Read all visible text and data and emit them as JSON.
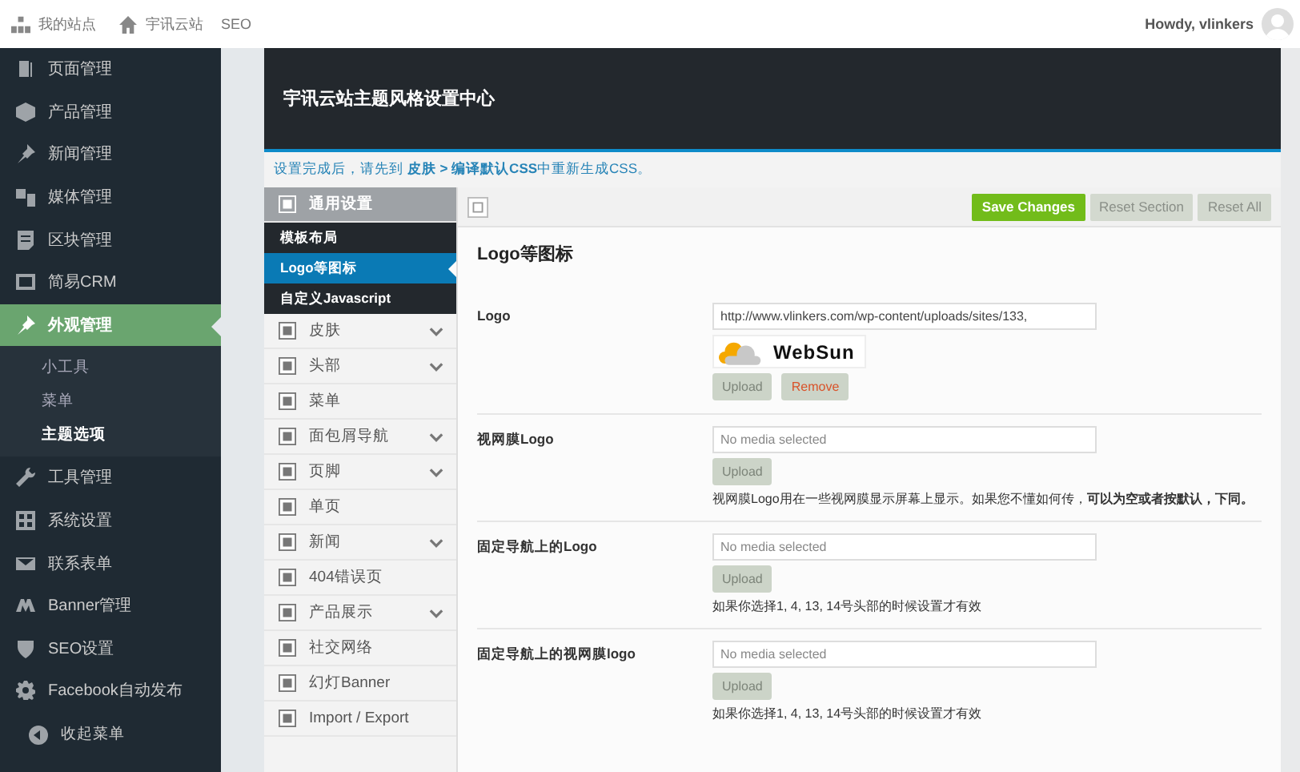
{
  "admin_bar": {
    "items": [
      "我的站点",
      "宇讯云站",
      "SEO"
    ],
    "greeting": "Howdy, vlinkers"
  },
  "sidebar": {
    "items": [
      {
        "label": "页面管理",
        "selected": false
      },
      {
        "label": "产品管理",
        "selected": false
      },
      {
        "label": "新闻管理",
        "selected": false
      },
      {
        "label": "媒体管理",
        "selected": false
      },
      {
        "label": "区块管理",
        "selected": false
      },
      {
        "label": "简易CRM",
        "selected": false
      },
      {
        "label": "外观管理",
        "selected": true,
        "children": [
          {
            "label": "小工具",
            "selected": false
          },
          {
            "label": "菜单",
            "selected": false
          },
          {
            "label": "主题选项",
            "selected": true
          }
        ]
      },
      {
        "label": "工具管理",
        "selected": false
      },
      {
        "label": "系统设置",
        "selected": false
      },
      {
        "label": "联系表单",
        "selected": false
      },
      {
        "label": "Banner管理",
        "selected": false
      },
      {
        "label": "SEO设置",
        "selected": false
      },
      {
        "label": "Facebook自动发布",
        "selected": false
      }
    ],
    "collapse": "收起菜单"
  },
  "header": {
    "title": "宇讯云站主题风格设置中心",
    "notice": "设置完成后，请先到 **皮肤 > 编译默认CSS**中重新生成CSS。"
  },
  "options_nav": [
    {
      "label": "通用设置",
      "expanded": true,
      "has_submenu": false,
      "children": [
        {
          "label": "模板布局",
          "selected": false
        },
        {
          "label": "Logo等图标",
          "selected": true
        },
        {
          "label": "自定义Javascript",
          "selected": false
        }
      ]
    },
    {
      "label": "皮肤",
      "expanded": false,
      "has_submenu": true
    },
    {
      "label": "头部",
      "expanded": false,
      "has_submenu": true
    },
    {
      "label": "菜单",
      "expanded": false,
      "has_submenu": false
    },
    {
      "label": "面包屑导航",
      "expanded": false,
      "has_submenu": true
    },
    {
      "label": "页脚",
      "expanded": false,
      "has_submenu": true
    },
    {
      "label": "单页",
      "expanded": false,
      "has_submenu": false
    },
    {
      "label": "新闻",
      "expanded": false,
      "has_submenu": true
    },
    {
      "label": "404错误页",
      "expanded": false,
      "has_submenu": false
    },
    {
      "label": "产品展示",
      "expanded": false,
      "has_submenu": true
    },
    {
      "label": "社交网络",
      "expanded": false,
      "has_submenu": false
    },
    {
      "label": "幻灯Banner",
      "expanded": false,
      "has_submenu": false
    },
    {
      "label": "Import / Export",
      "expanded": false,
      "has_submenu": false
    }
  ],
  "toolbar": {
    "buttons": [
      {
        "label": "Save Changes",
        "kind": "primary"
      },
      {
        "label": "Reset Section",
        "kind": "secondary"
      },
      {
        "label": "Reset All",
        "kind": "secondary"
      }
    ]
  },
  "section": {
    "title": "Logo等图标",
    "fields": [
      {
        "label": "Logo",
        "value": "http://www.vlinkers.com/wp-content/uploads/sites/133,",
        "preview_text": "WebSun",
        "buttons": [
          {
            "label": "Upload",
            "kind": "upload"
          },
          {
            "label": "Remove",
            "kind": "remove"
          }
        ]
      },
      {
        "label": "视网膜Logo",
        "placeholder": "No media selected",
        "buttons": [
          {
            "label": "Upload",
            "kind": "upload"
          }
        ],
        "description": "视网膜Logo用在一些视网膜显示屏幕上显示。如果您不懂如何传，**可以为空或者按默认，下同。**"
      },
      {
        "label": "固定导航上的Logo",
        "placeholder": "No media selected",
        "buttons": [
          {
            "label": "Upload",
            "kind": "upload"
          }
        ],
        "description": "如果你选择1, 4, 13, 14号头部的时候设置才有效"
      },
      {
        "label": "固定导航上的视网膜logo",
        "placeholder": "No media selected",
        "buttons": [
          {
            "label": "Upload",
            "kind": "upload"
          }
        ],
        "description": "如果你选择1, 4, 13, 14号头部的时候设置才有效"
      }
    ]
  }
}
